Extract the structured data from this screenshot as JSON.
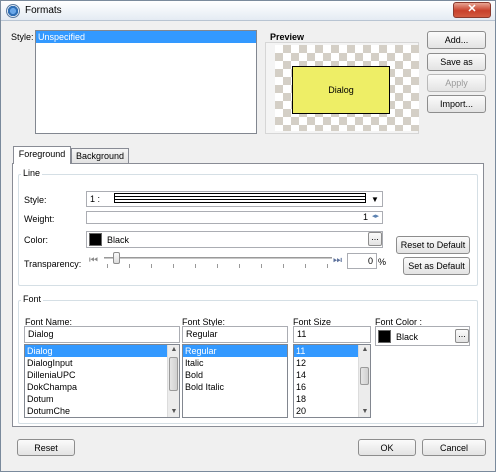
{
  "window": {
    "title": "Formats",
    "close_glyph": "✕"
  },
  "style_section": {
    "label": "Style:",
    "items": [
      "Unspecified"
    ]
  },
  "preview": {
    "label": "Preview",
    "dialog_text": "Dialog",
    "dialog_color": "#eeee66"
  },
  "side_buttons": {
    "add": "Add...",
    "save_as": "Save as",
    "apply": "Apply",
    "import": "Import..."
  },
  "tabs": [
    {
      "label": "Foreground"
    },
    {
      "label": "Background"
    }
  ],
  "line_group": {
    "title": "Line",
    "style_label": "Style:",
    "style_value": "1 :",
    "weight_label": "Weight:",
    "weight_value": "1",
    "color_label": "Color:",
    "color_value": "Black",
    "color_swatch": "#000000",
    "ellipsis": "...",
    "transparency_label": "Transparency:",
    "transparency_value": "0",
    "transparency_unit": "%",
    "transparency_level": 0,
    "reset_default": "Reset to Default",
    "set_default": "Set as Default"
  },
  "font_group": {
    "title": "Font",
    "name_label": "Font Name:",
    "name_value": "Dialog",
    "names": [
      "Dialog",
      "DialogInput",
      "DilleniaUPC",
      "DokChampa",
      "Dotum",
      "DotumChe"
    ],
    "style_label": "Font Style:",
    "style_value": "Regular",
    "styles": [
      "Regular",
      "Italic",
      "Bold",
      "Bold Italic"
    ],
    "size_label": "Font Size",
    "size_value": "11",
    "sizes": [
      "11",
      "12",
      "14",
      "16",
      "18",
      "20"
    ],
    "color_label": "Font Color :",
    "color_value": "Black",
    "ellipsis": "..."
  },
  "footer": {
    "reset": "Reset",
    "ok": "OK",
    "cancel": "Cancel"
  }
}
